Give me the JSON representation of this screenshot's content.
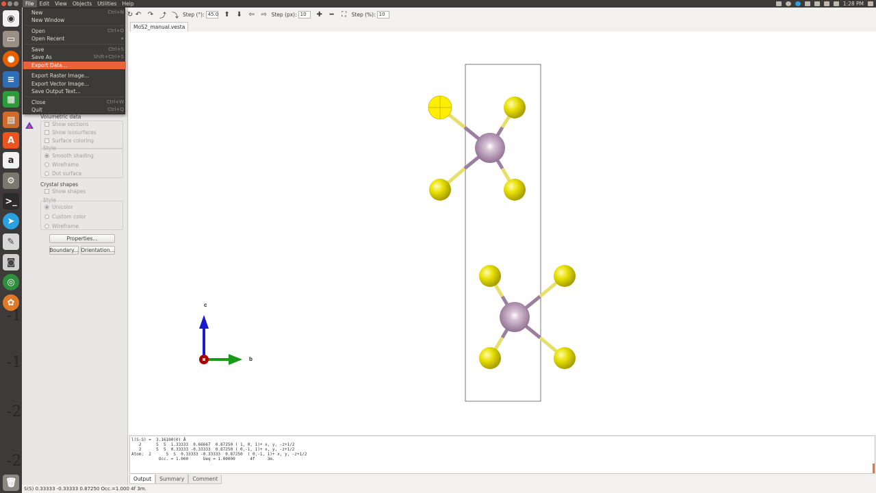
{
  "menubar": [
    "File",
    "Edit",
    "View",
    "Objects",
    "Utilities",
    "Help"
  ],
  "clock": "1:28 PM",
  "file_menu": {
    "items": [
      {
        "label": "New",
        "shortcut": "Ctrl+N"
      },
      {
        "label": "New Window",
        "shortcut": ""
      },
      {
        "label": "Open",
        "shortcut": "Ctrl+O"
      },
      {
        "label": "Open Recent",
        "shortcut": "▸"
      },
      {
        "label": "Save",
        "shortcut": "Ctrl+S"
      },
      {
        "label": "Save As",
        "shortcut": "Shift+Ctrl+S"
      },
      {
        "label": "Export Data...",
        "shortcut": ""
      },
      {
        "label": "Export Raster Image...",
        "shortcut": ""
      },
      {
        "label": "Export Vector Image...",
        "shortcut": ""
      },
      {
        "label": "Save Output Text...",
        "shortcut": ""
      },
      {
        "label": "Close",
        "shortcut": "Ctrl+W"
      },
      {
        "label": "Quit",
        "shortcut": "Ctrl+Q"
      }
    ],
    "highlighted": "Export Data..."
  },
  "toolbar": {
    "step_deg_label": "Step (°):",
    "step_deg_value": "45.0",
    "step_px_label": "Step (px):",
    "step_px_value": "10",
    "step_pct_label": "Step (%):",
    "step_pct_value": "10"
  },
  "document_tab": "MoS2_manual.vesta",
  "side_panel": {
    "volumetric": {
      "heading": "Volumetric data",
      "checks": [
        "Show sections",
        "Show isosurfaces",
        "Surface coloring"
      ],
      "style_label": "Style",
      "styles": [
        "Smooth shading",
        "Wireframe",
        "Dot surface"
      ]
    },
    "crystal": {
      "heading": "Crystal shapes",
      "checks": [
        "Show shapes"
      ],
      "style_label": "Style",
      "styles": [
        "Unicolor",
        "Custom color",
        "Wireframe"
      ]
    },
    "buttons": {
      "properties": "Properties...",
      "boundary": "Boundary...",
      "orientation": "Orientation..."
    }
  },
  "launcher_bg_text": [
    "-1",
    "-1",
    "-2",
    "-2"
  ],
  "axes": {
    "c": "c",
    "b": "b"
  },
  "output_lines": [
    "l(S-S) =  3.16100(0) Å",
    "   2      S  S  1.33333  0.66667  0.87250 ( 1, 0, 1)+ x, y, -z+1/2",
    "   2      S  S  0.33333 -0.33333  0.87250 ( 0,-1, 1)+ x, y, -z+1/2",
    "",
    "Atom:  2      S  S  0.33333 -0.33333  0.87250  ( 0,-1, 1)+ x, y, -z+1/2",
    "           Occ. = 1.000      Ueq = 1.00000      4f     3m."
  ],
  "output_tabs": [
    "Output",
    "Summary",
    "Comment"
  ],
  "status_bar": "S(S) 0.33333 -0.33333 0.87250 Occ.=1.000 4f    3m.",
  "colors": {
    "molybdenum": "#a783a4",
    "sulfur": "#e8e000",
    "bond_mo": "#9a7f9e",
    "bond_s": "#e6e06a",
    "axis_c": "#1a1acc",
    "axis_b": "#1a9a1a",
    "axis_a": "#aa0000",
    "menu_highlight": "#e9643a"
  }
}
